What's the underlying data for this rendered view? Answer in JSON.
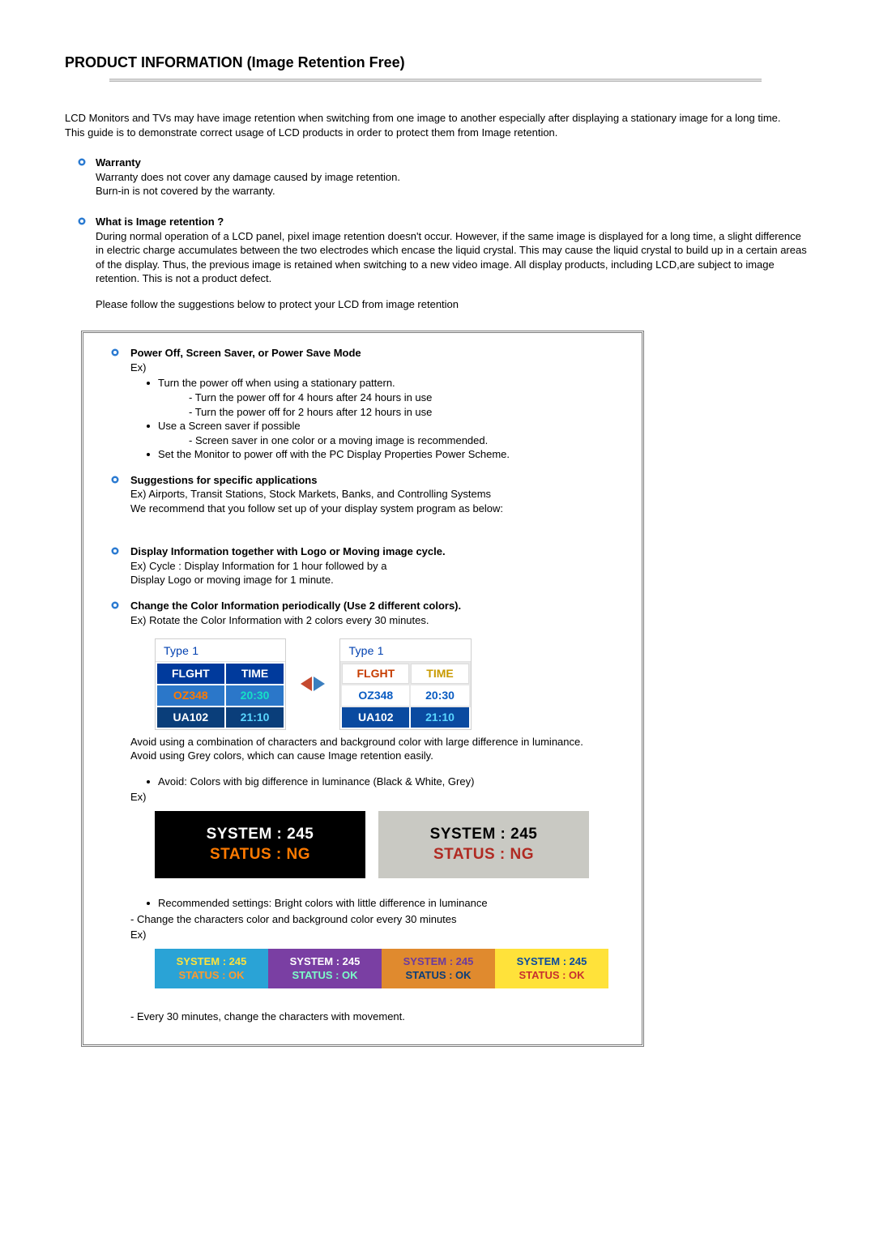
{
  "title": "PRODUCT INFORMATION (Image Retention Free)",
  "intro": {
    "p1": "LCD Monitors and TVs may have image retention when switching from one image to another especially after displaying a stationary image for a long time.",
    "p2": "This guide is to demonstrate correct usage of LCD products in order to protect them from Image retention."
  },
  "warranty": {
    "title": "Warranty",
    "line1": "Warranty does not cover any damage caused by image retention.",
    "line2": "Burn-in is not covered by the warranty."
  },
  "retention": {
    "title": "What is Image retention ?",
    "body": "During normal operation of a LCD panel, pixel image retention doesn't occur. However, if the same image is displayed for a long time, a slight difference in electric charge accumulates between the two electrodes which encase the liquid crystal. This may cause the liquid crystal to build up in a certain areas of the display. Thus, the previous image is retained when switching to a new video image. All display products, including LCD,are subject to image retention. This is not a product defect.",
    "follow": "Please follow the suggestions below to protect your LCD from image retention"
  },
  "box": {
    "poweroff": {
      "title": "Power Off, Screen Saver, or Power Save Mode",
      "ex": "Ex)",
      "b1": "Turn the power off when using a stationary pattern.",
      "b1s1": "Turn the power off for 4 hours after 24 hours in use",
      "b1s2": "Turn the power off for 2 hours after 12 hours in use",
      "b2": "Use a Screen saver if possible",
      "b2s1": "Screen saver in one color or a moving image is recommended.",
      "b3": "Set the Monitor to power off with the PC Display Properties Power Scheme."
    },
    "suggestions": {
      "title": "Suggestions for specific applications",
      "line1": "Ex) Airports, Transit Stations, Stock Markets, Banks, and Controlling Systems",
      "line2": "We recommend that you follow set up of your display system program as below:"
    },
    "displayinfo": {
      "title": "Display Information together with Logo or Moving image cycle.",
      "line1": "Ex) Cycle : Display Information for 1 hour followed by a",
      "line2": "Display Logo or moving image for 1 minute."
    },
    "changecolor": {
      "title": "Change the Color Information periodically (Use 2 different colors).",
      "line1": "Ex) Rotate the Color Information with 2 colors every 30 minutes."
    },
    "type1": {
      "caption": "Type 1",
      "hdr_flight": "FLGHT",
      "hdr_time": "TIME",
      "r1c1": "OZ348",
      "r1c2": "20:30",
      "r2c1": "UA102",
      "r2c2": "21:10"
    },
    "avoidtext": {
      "l1": "Avoid using a combination of characters and background color with large difference in luminance.",
      "l2": "Avoid using Grey colors, which can cause Image retention easily."
    },
    "avoidbullet": "Avoid: Colors with big difference in luminance (Black & White, Grey)",
    "ex_label": "Ex)",
    "avoidpanels": {
      "sys": "SYSTEM : 245",
      "status_ng": "STATUS : NG"
    },
    "recbullet": "Recommended settings: Bright colors with little difference in luminance",
    "recdash": "Change the characters color and background color every 30 minutes",
    "recstrip": {
      "sys": "SYSTEM : 245",
      "status_ok": "STATUS : OK"
    },
    "final": "Every 30 minutes, change the characters with movement."
  }
}
